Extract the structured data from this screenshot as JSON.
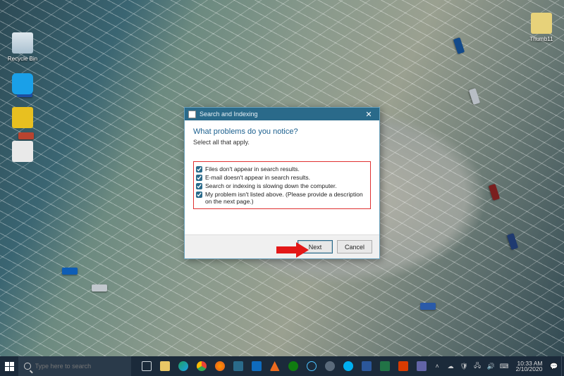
{
  "desktop": {
    "icons": {
      "recycle_bin": "Recycle Bin",
      "thumbs": "Thumb11"
    }
  },
  "dialog": {
    "title": "Search and Indexing",
    "heading": "What problems do you notice?",
    "subheading": "Select all that apply.",
    "options": [
      "Files don't appear in search results.",
      "E-mail doesn't appear in search results.",
      "Search or indexing is slowing down the computer.",
      "My problem isn't listed above. (Please provide a description on the next page.)"
    ],
    "buttons": {
      "next": "Next",
      "cancel": "Cancel"
    },
    "close_glyph": "✕"
  },
  "taskbar": {
    "search_placeholder": "Type here to search",
    "tray": {
      "chevron": "˄",
      "net": "🖧",
      "vol": "🔊",
      "lang": "⌨"
    },
    "clock": {
      "time": "10:33 AM",
      "date": "2/10/2020"
    },
    "notify_glyph": "💬"
  },
  "colors": {
    "accent": "#2a6a8a",
    "highlight": "#e03030",
    "taskbar": "#1b2a3a"
  }
}
